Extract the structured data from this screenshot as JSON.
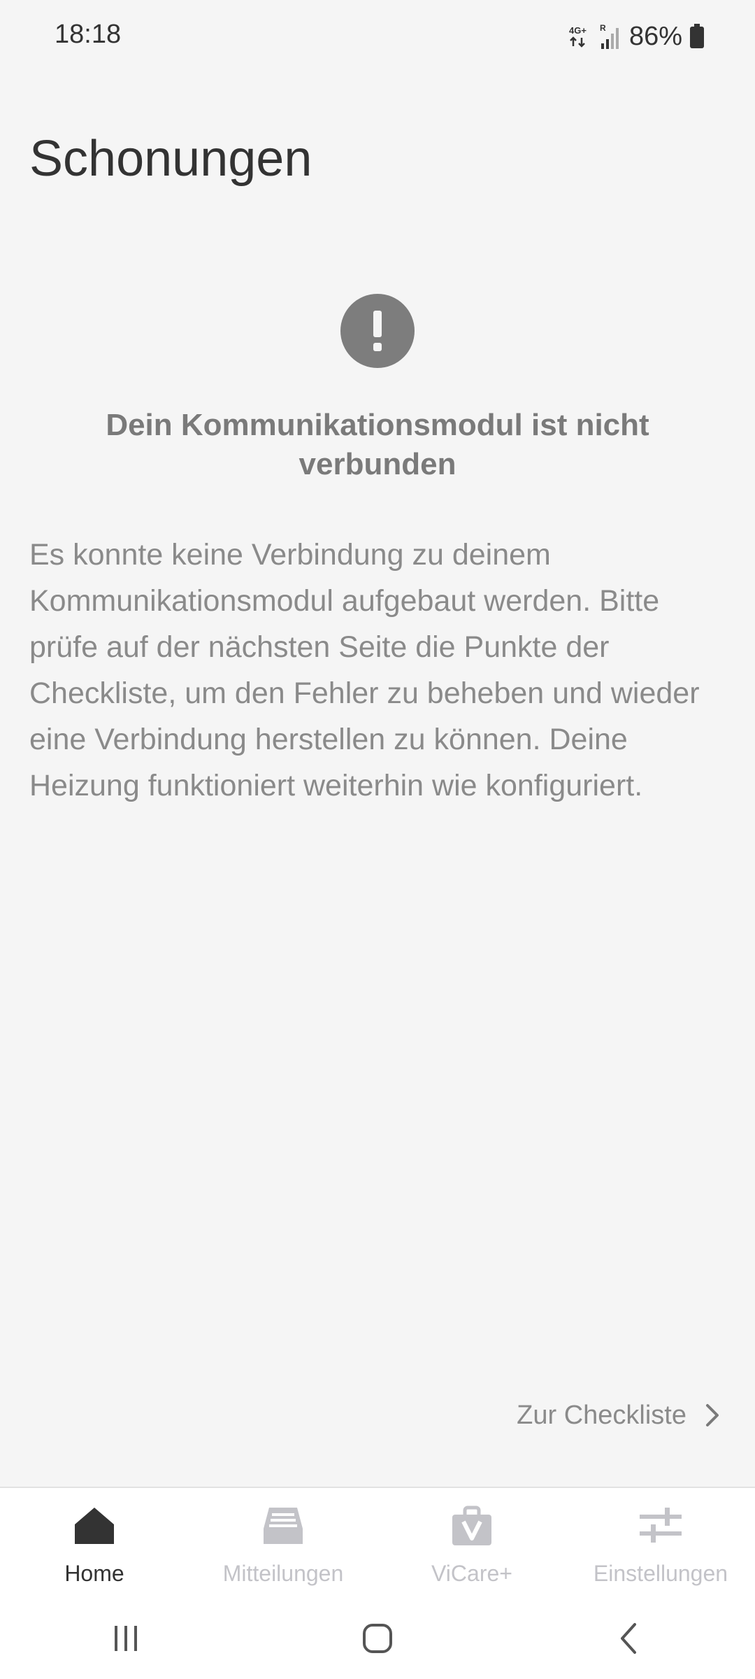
{
  "status_bar": {
    "time": "18:18",
    "network": "4G+",
    "roaming": "R",
    "battery": "86%"
  },
  "page": {
    "title": "Schonungen"
  },
  "error": {
    "icon": "exclamation-icon",
    "title": "Dein Kommunikationsmodul ist nicht verbunden",
    "body": "Es konnte keine Verbindung zu deinem Kommunikationsmodul aufgebaut werden. Bitte prüfe auf der nächsten Seite die Punkte der Checkliste, um den Fehler zu beheben und wieder eine Verbindung herstellen zu können. Deine Heizung funktioniert weiterhin wie konfiguriert."
  },
  "checklist_link": {
    "label": "Zur Checkliste",
    "icon": "chevron-right-icon"
  },
  "bottom_nav": {
    "active": "Home",
    "items": [
      {
        "label": "Home",
        "icon": "home-icon"
      },
      {
        "label": "Mitteilungen",
        "icon": "inbox-icon"
      },
      {
        "label": "ViCare+",
        "icon": "shopping-bag-icon"
      },
      {
        "label": "Einstellungen",
        "icon": "sliders-icon"
      }
    ]
  },
  "colors": {
    "background": "#f5f5f5",
    "active": "#333333",
    "inactive": "#c3c3c8",
    "muted_text": "#8a8a8a"
  }
}
